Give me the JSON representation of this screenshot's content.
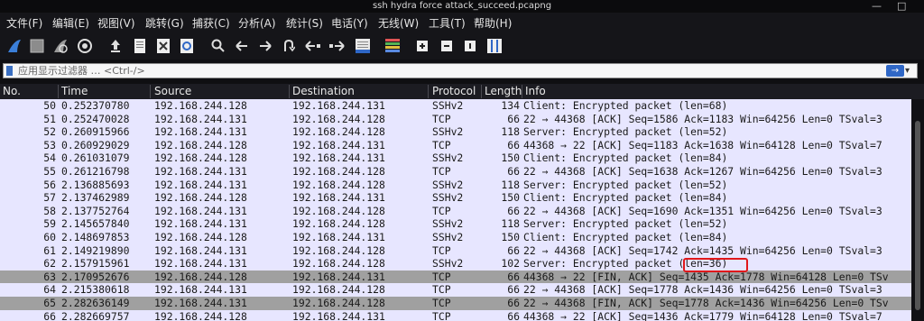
{
  "window": {
    "title": "ssh hydra force attack_succeed.pcapng",
    "minimize": "—",
    "maximize": "□"
  },
  "menu": [
    "文件(F)",
    "编辑(E)",
    "视图(V)",
    "跳转(G)",
    "捕获(C)",
    "分析(A)",
    "统计(S)",
    "电话(Y)",
    "无线(W)",
    "工具(T)",
    "帮助(H)"
  ],
  "toolbar": {
    "icons": [
      "shark-fin-icon",
      "stop-icon",
      "restart-icon",
      "options-gear-icon",
      "open-file-icon",
      "save-file-icon",
      "close-file-icon",
      "reload-icon",
      "search-icon",
      "back-arrow-icon",
      "forward-arrow-icon",
      "jump-icon",
      "first-packet-icon",
      "last-packet-icon",
      "autoscroll-icon",
      "colorize-icon",
      "zoom-in-icon",
      "zoom-out-icon",
      "normal-size-icon",
      "resize-columns-icon"
    ]
  },
  "filter": {
    "placeholder": "应用显示过滤器 … <Ctrl-/>",
    "apply": "→"
  },
  "columns": [
    "No.",
    "Time",
    "Source",
    "Destination",
    "Protocol",
    "Length",
    "Info"
  ],
  "rows": [
    {
      "no": "50",
      "time": "0.252370780",
      "src": "192.168.244.128",
      "dst": "192.168.244.131",
      "proto": "SSHv2",
      "len": "134",
      "info": "Client: Encrypted packet (len=68)",
      "kind": "norm"
    },
    {
      "no": "51",
      "time": "0.252470028",
      "src": "192.168.244.131",
      "dst": "192.168.244.128",
      "proto": "TCP",
      "len": "66",
      "info": "22 → 44368 [ACK] Seq=1586 Ack=1183 Win=64256 Len=0 TSval=3",
      "kind": "norm"
    },
    {
      "no": "52",
      "time": "0.260915966",
      "src": "192.168.244.131",
      "dst": "192.168.244.128",
      "proto": "SSHv2",
      "len": "118",
      "info": "Server: Encrypted packet (len=52)",
      "kind": "norm"
    },
    {
      "no": "53",
      "time": "0.260929029",
      "src": "192.168.244.128",
      "dst": "192.168.244.131",
      "proto": "TCP",
      "len": "66",
      "info": "44368 → 22 [ACK] Seq=1183 Ack=1638 Win=64128 Len=0 TSval=7",
      "kind": "norm"
    },
    {
      "no": "54",
      "time": "0.261031079",
      "src": "192.168.244.128",
      "dst": "192.168.244.131",
      "proto": "SSHv2",
      "len": "150",
      "info": "Client: Encrypted packet (len=84)",
      "kind": "norm"
    },
    {
      "no": "55",
      "time": "0.261216798",
      "src": "192.168.244.131",
      "dst": "192.168.244.128",
      "proto": "TCP",
      "len": "66",
      "info": "22 → 44368 [ACK] Seq=1638 Ack=1267 Win=64256 Len=0 TSval=3",
      "kind": "norm"
    },
    {
      "no": "56",
      "time": "2.136885693",
      "src": "192.168.244.131",
      "dst": "192.168.244.128",
      "proto": "SSHv2",
      "len": "118",
      "info": "Server: Encrypted packet (len=52)",
      "kind": "norm"
    },
    {
      "no": "57",
      "time": "2.137462989",
      "src": "192.168.244.128",
      "dst": "192.168.244.131",
      "proto": "SSHv2",
      "len": "150",
      "info": "Client: Encrypted packet (len=84)",
      "kind": "norm"
    },
    {
      "no": "58",
      "time": "2.137752764",
      "src": "192.168.244.131",
      "dst": "192.168.244.128",
      "proto": "TCP",
      "len": "66",
      "info": "22 → 44368 [ACK] Seq=1690 Ack=1351 Win=64256 Len=0 TSval=3",
      "kind": "norm"
    },
    {
      "no": "59",
      "time": "2.145657840",
      "src": "192.168.244.131",
      "dst": "192.168.244.128",
      "proto": "SSHv2",
      "len": "118",
      "info": "Server: Encrypted packet (len=52)",
      "kind": "norm"
    },
    {
      "no": "60",
      "time": "2.148697853",
      "src": "192.168.244.128",
      "dst": "192.168.244.131",
      "proto": "SSHv2",
      "len": "150",
      "info": "Client: Encrypted packet (len=84)",
      "kind": "norm"
    },
    {
      "no": "61",
      "time": "2.149219890",
      "src": "192.168.244.131",
      "dst": "192.168.244.128",
      "proto": "TCP",
      "len": "66",
      "info": "22 → 44368 [ACK] Seq=1742 Ack=1435 Win=64256 Len=0 TSval=3",
      "kind": "norm"
    },
    {
      "no": "62",
      "time": "2.157915961",
      "src": "192.168.244.131",
      "dst": "192.168.244.128",
      "proto": "SSHv2",
      "len": "102",
      "info": "Server: Encrypted packet (len=36)",
      "kind": "norm"
    },
    {
      "no": "63",
      "time": "2.170952676",
      "src": "192.168.244.128",
      "dst": "192.168.244.131",
      "proto": "TCP",
      "len": "66",
      "info": "44368 → 22 [FIN, ACK] Seq=1435 Ack=1778 Win=64128 Len=0 TSv",
      "kind": "fin"
    },
    {
      "no": "64",
      "time": "2.215380618",
      "src": "192.168.244.131",
      "dst": "192.168.244.128",
      "proto": "TCP",
      "len": "66",
      "info": "22 → 44368 [ACK] Seq=1778 Ack=1436 Win=64256 Len=0 TSval=3",
      "kind": "norm"
    },
    {
      "no": "65",
      "time": "2.282636149",
      "src": "192.168.244.131",
      "dst": "192.168.244.128",
      "proto": "TCP",
      "len": "66",
      "info": "22 → 44368 [FIN, ACK] Seq=1778 Ack=1436 Win=64256 Len=0 TSv",
      "kind": "fin"
    },
    {
      "no": "66",
      "time": "2.282669757",
      "src": "192.168.244.128",
      "dst": "192.168.244.131",
      "proto": "TCP",
      "len": "66",
      "info": "44368 → 22 [ACK] Seq=1436 Ack=1779 Win=64128 Len=0 TSval=7",
      "kind": "norm"
    }
  ],
  "colors": {
    "row_normal": "#e7e6ff",
    "row_fin": "#a0a0a0",
    "highlight_box": "#e0181b"
  }
}
